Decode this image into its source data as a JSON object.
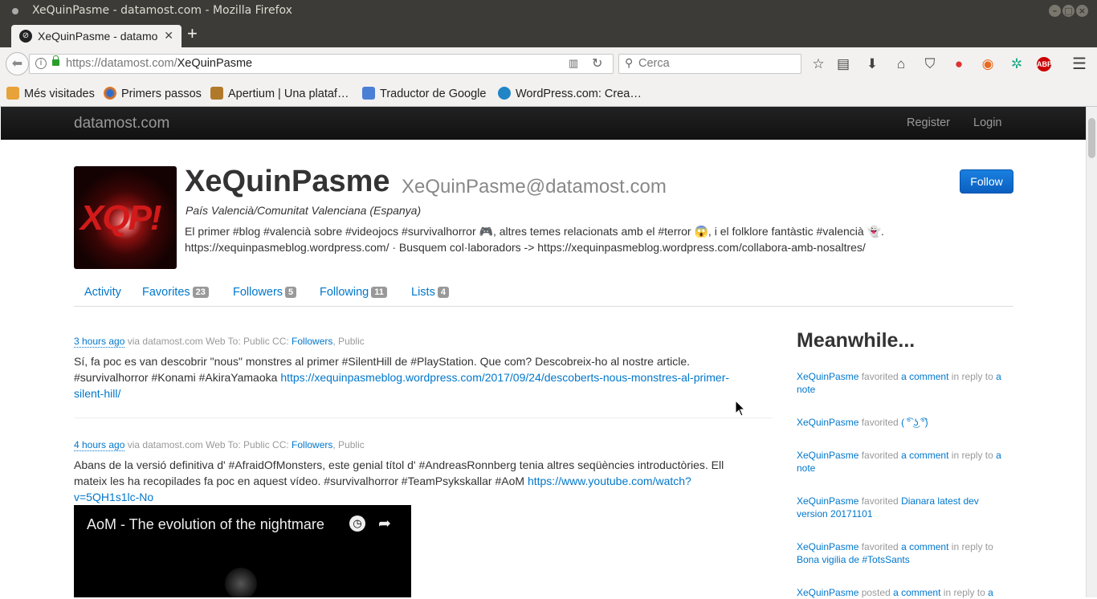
{
  "window": {
    "title": "XeQuinPasme - datamost.com - Mozilla Firefox"
  },
  "tab": {
    "label": "XeQuinPasme - datamost.com"
  },
  "navbar": {
    "url_host": "https://datamost.com/",
    "url_path": "XeQuinPasme",
    "search_placeholder": "Cerca"
  },
  "bookmarks": [
    {
      "label": "Més visitades"
    },
    {
      "label": "Primers passos"
    },
    {
      "label": "Apertium | Una plataf…"
    },
    {
      "label": "Traductor de Google"
    },
    {
      "label": "WordPress.com: Crea…"
    }
  ],
  "site": {
    "brand": "datamost.com",
    "register": "Register",
    "login": "Login"
  },
  "profile": {
    "avatar_text": "XQP!",
    "name": "XeQuinPasme",
    "handle": "XeQuinPasme@datamost.com",
    "location": "País Valencià/Comunitat Valenciana (Espanya)",
    "bio_line1": "El primer #blog #valencià sobre #videojocs #survivalhorror 🎮, altres temes relacionats amb el #terror 😱, i el folklore fantàstic #valencià 👻.",
    "bio_line2": "https://xequinpasmeblog.wordpress.com/ · Busquem col·laboradors -> https://xequinpasmeblog.wordpress.com/collabora-amb-nosaltres/",
    "follow": "Follow"
  },
  "tabs": [
    {
      "label": "Activity",
      "count": ""
    },
    {
      "label": "Favorites",
      "count": "23"
    },
    {
      "label": "Followers",
      "count": "5"
    },
    {
      "label": "Following",
      "count": "11"
    },
    {
      "label": "Lists",
      "count": "4"
    }
  ],
  "posts": [
    {
      "time": "3 hours ago",
      "meta": " via datamost.com Web To: Public CC: ",
      "cc_link": "Followers",
      "cc_rest": ", Public",
      "text": "Sí, fa poc es van descobrir \"nous\" monstres al primer #SilentHill de #PlayStation. Que com? Descobreix-ho al nostre article. #survivalhorror #Konami #AkiraYamaoka ",
      "link": "https://xequinpasmeblog.wordpress.com/2017/09/24/descoberts-nous-monstres-al-primer-silent-hill/"
    },
    {
      "time": "4 hours ago",
      "meta": " via datamost.com Web To: Public CC: ",
      "cc_link": "Followers",
      "cc_rest": ", Public",
      "text": "Abans de la versió definitiva d' #AfraidOfMonsters, este genial títol d' #AndreasRonnberg tenia altres seqüències introductòries. Ell mateix les ha recopilades fa poc en aquest vídeo. #survivalhorror #TeamPsykskallar #AoM ",
      "link": "https://www.youtube.com/watch?v=5QH1s1lc-No",
      "video_title": "AoM - The evolution of the nightmare"
    }
  ],
  "sidebar": {
    "title": "Meanwhile...",
    "activities": [
      {
        "actor": "XeQuinPasme",
        "verb": " favorited ",
        "object": "a comment",
        "mid": " in reply to ",
        "target": "a note"
      },
      {
        "actor": "XeQuinPasme",
        "verb": " favorited ",
        "object": "( ͡° ͜ʖ ͡°)",
        "mid": "",
        "target": ""
      },
      {
        "actor": "XeQuinPasme",
        "verb": " favorited ",
        "object": "a comment",
        "mid": " in reply to ",
        "target": "a note"
      },
      {
        "actor": "XeQuinPasme",
        "verb": " favorited ",
        "object": "Dianara latest dev version 20171101",
        "mid": "",
        "target": ""
      },
      {
        "actor": "XeQuinPasme",
        "verb": " favorited ",
        "object": "a comment",
        "mid": " in reply to ",
        "target": "Bona vigilia de #TotsSants"
      },
      {
        "actor": "XeQuinPasme",
        "verb": " posted ",
        "object": "a comment",
        "mid": " in reply to ",
        "target": "a"
      }
    ]
  }
}
